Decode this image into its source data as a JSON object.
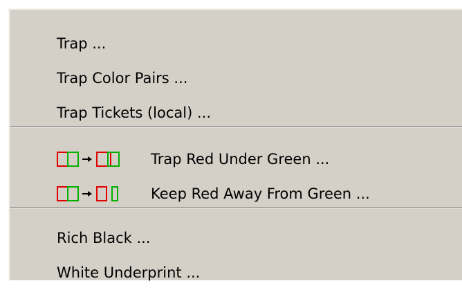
{
  "menu": {
    "items": [
      {
        "label": "Trap ..."
      },
      {
        "label": "Trap Color Pairs ..."
      },
      {
        "label": "Trap Tickets (local) ..."
      },
      {
        "label": "Trap Red Under Green ...",
        "icon": "trap-red-under-green-icon"
      },
      {
        "label": "Keep Red Away From Green ...",
        "icon": "keep-red-away-from-green-icon"
      },
      {
        "label": "Rich Black ..."
      },
      {
        "label": "White Underprint ..."
      }
    ]
  },
  "colors": {
    "menu_background": "#d4d0c8",
    "red": "#e00000",
    "green": "#00b000"
  }
}
